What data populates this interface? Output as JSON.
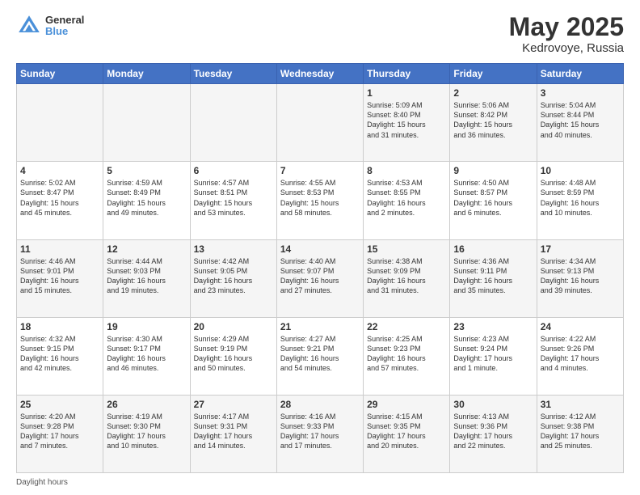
{
  "header": {
    "logo_line1": "General",
    "logo_line2": "Blue",
    "title": "May 2025",
    "subtitle": "Kedrovoye, Russia"
  },
  "days_of_week": [
    "Sunday",
    "Monday",
    "Tuesday",
    "Wednesday",
    "Thursday",
    "Friday",
    "Saturday"
  ],
  "footer_text": "Daylight hours",
  "weeks": [
    [
      {
        "day": "",
        "content": ""
      },
      {
        "day": "",
        "content": ""
      },
      {
        "day": "",
        "content": ""
      },
      {
        "day": "",
        "content": ""
      },
      {
        "day": "1",
        "content": "Sunrise: 5:09 AM\nSunset: 8:40 PM\nDaylight: 15 hours\nand 31 minutes."
      },
      {
        "day": "2",
        "content": "Sunrise: 5:06 AM\nSunset: 8:42 PM\nDaylight: 15 hours\nand 36 minutes."
      },
      {
        "day": "3",
        "content": "Sunrise: 5:04 AM\nSunset: 8:44 PM\nDaylight: 15 hours\nand 40 minutes."
      }
    ],
    [
      {
        "day": "4",
        "content": "Sunrise: 5:02 AM\nSunset: 8:47 PM\nDaylight: 15 hours\nand 45 minutes."
      },
      {
        "day": "5",
        "content": "Sunrise: 4:59 AM\nSunset: 8:49 PM\nDaylight: 15 hours\nand 49 minutes."
      },
      {
        "day": "6",
        "content": "Sunrise: 4:57 AM\nSunset: 8:51 PM\nDaylight: 15 hours\nand 53 minutes."
      },
      {
        "day": "7",
        "content": "Sunrise: 4:55 AM\nSunset: 8:53 PM\nDaylight: 15 hours\nand 58 minutes."
      },
      {
        "day": "8",
        "content": "Sunrise: 4:53 AM\nSunset: 8:55 PM\nDaylight: 16 hours\nand 2 minutes."
      },
      {
        "day": "9",
        "content": "Sunrise: 4:50 AM\nSunset: 8:57 PM\nDaylight: 16 hours\nand 6 minutes."
      },
      {
        "day": "10",
        "content": "Sunrise: 4:48 AM\nSunset: 8:59 PM\nDaylight: 16 hours\nand 10 minutes."
      }
    ],
    [
      {
        "day": "11",
        "content": "Sunrise: 4:46 AM\nSunset: 9:01 PM\nDaylight: 16 hours\nand 15 minutes."
      },
      {
        "day": "12",
        "content": "Sunrise: 4:44 AM\nSunset: 9:03 PM\nDaylight: 16 hours\nand 19 minutes."
      },
      {
        "day": "13",
        "content": "Sunrise: 4:42 AM\nSunset: 9:05 PM\nDaylight: 16 hours\nand 23 minutes."
      },
      {
        "day": "14",
        "content": "Sunrise: 4:40 AM\nSunset: 9:07 PM\nDaylight: 16 hours\nand 27 minutes."
      },
      {
        "day": "15",
        "content": "Sunrise: 4:38 AM\nSunset: 9:09 PM\nDaylight: 16 hours\nand 31 minutes."
      },
      {
        "day": "16",
        "content": "Sunrise: 4:36 AM\nSunset: 9:11 PM\nDaylight: 16 hours\nand 35 minutes."
      },
      {
        "day": "17",
        "content": "Sunrise: 4:34 AM\nSunset: 9:13 PM\nDaylight: 16 hours\nand 39 minutes."
      }
    ],
    [
      {
        "day": "18",
        "content": "Sunrise: 4:32 AM\nSunset: 9:15 PM\nDaylight: 16 hours\nand 42 minutes."
      },
      {
        "day": "19",
        "content": "Sunrise: 4:30 AM\nSunset: 9:17 PM\nDaylight: 16 hours\nand 46 minutes."
      },
      {
        "day": "20",
        "content": "Sunrise: 4:29 AM\nSunset: 9:19 PM\nDaylight: 16 hours\nand 50 minutes."
      },
      {
        "day": "21",
        "content": "Sunrise: 4:27 AM\nSunset: 9:21 PM\nDaylight: 16 hours\nand 54 minutes."
      },
      {
        "day": "22",
        "content": "Sunrise: 4:25 AM\nSunset: 9:23 PM\nDaylight: 16 hours\nand 57 minutes."
      },
      {
        "day": "23",
        "content": "Sunrise: 4:23 AM\nSunset: 9:24 PM\nDaylight: 17 hours\nand 1 minute."
      },
      {
        "day": "24",
        "content": "Sunrise: 4:22 AM\nSunset: 9:26 PM\nDaylight: 17 hours\nand 4 minutes."
      }
    ],
    [
      {
        "day": "25",
        "content": "Sunrise: 4:20 AM\nSunset: 9:28 PM\nDaylight: 17 hours\nand 7 minutes."
      },
      {
        "day": "26",
        "content": "Sunrise: 4:19 AM\nSunset: 9:30 PM\nDaylight: 17 hours\nand 10 minutes."
      },
      {
        "day": "27",
        "content": "Sunrise: 4:17 AM\nSunset: 9:31 PM\nDaylight: 17 hours\nand 14 minutes."
      },
      {
        "day": "28",
        "content": "Sunrise: 4:16 AM\nSunset: 9:33 PM\nDaylight: 17 hours\nand 17 minutes."
      },
      {
        "day": "29",
        "content": "Sunrise: 4:15 AM\nSunset: 9:35 PM\nDaylight: 17 hours\nand 20 minutes."
      },
      {
        "day": "30",
        "content": "Sunrise: 4:13 AM\nSunset: 9:36 PM\nDaylight: 17 hours\nand 22 minutes."
      },
      {
        "day": "31",
        "content": "Sunrise: 4:12 AM\nSunset: 9:38 PM\nDaylight: 17 hours\nand 25 minutes."
      }
    ]
  ]
}
